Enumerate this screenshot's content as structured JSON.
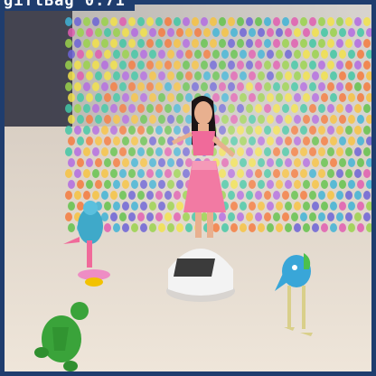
{
  "annotation": {
    "label": "giftBag",
    "score": "0.71",
    "box_color": "#1f3d6e",
    "text_color": "#ffffff"
  },
  "scene": {
    "description_objects": [
      "beaded-curtain-backdrop",
      "hula-dancer-figurine",
      "solar-base",
      "parrot-toy",
      "turtle-toy",
      "bird-toy"
    ],
    "colors": {
      "wall": "#c9c4bf",
      "table": "#e8ddd0",
      "hula_skirt": "#f27aa3",
      "turtle": "#3aa33a",
      "bird": "#39a6d8",
      "parrot": "#3fa9c9"
    }
  }
}
